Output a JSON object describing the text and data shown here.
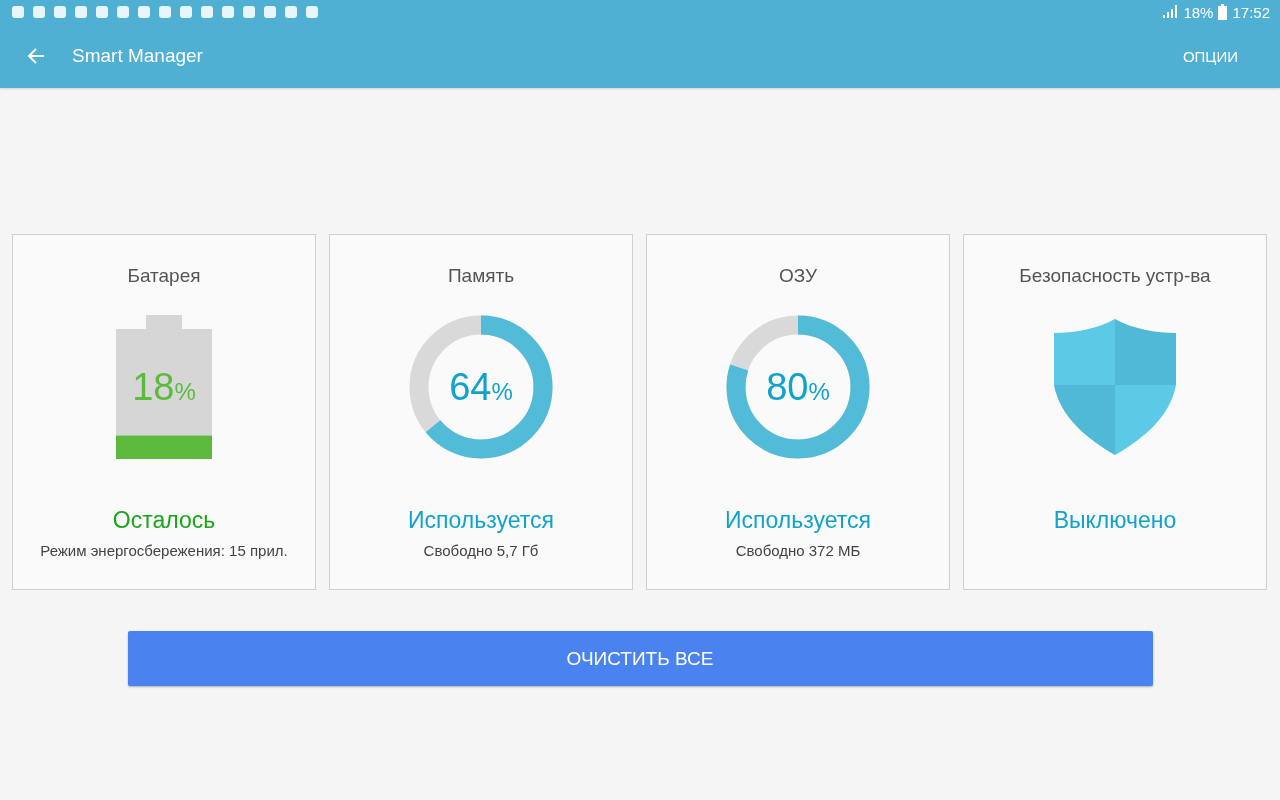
{
  "status_bar": {
    "battery": "18%",
    "time": "17:52"
  },
  "app_bar": {
    "title": "Smart Manager",
    "options": "ОПЦИИ"
  },
  "cards": [
    {
      "kind": "battery",
      "title": "Батарея",
      "value": "18",
      "unit": "%",
      "level": 0.18,
      "status": "Осталось",
      "color": "#1aa51a",
      "detail": "Режим энергосбережения: 15 прил."
    },
    {
      "kind": "donut",
      "title": "Память",
      "value": "64",
      "unit": "%",
      "level": 0.64,
      "status": "Используется",
      "color": "#0fa3cc",
      "detail": "Свободно 5,7 Гб"
    },
    {
      "kind": "donut",
      "title": "ОЗУ",
      "value": "80",
      "unit": "%",
      "level": 0.8,
      "status": "Используется",
      "color": "#0fa3cc",
      "detail": "Свободно 372 МБ"
    },
    {
      "kind": "shield",
      "title": "Безопасность устр-ва",
      "status": "Выключено",
      "color": "#0fa3cc"
    }
  ],
  "button": "ОЧИСТИТЬ ВСЕ"
}
